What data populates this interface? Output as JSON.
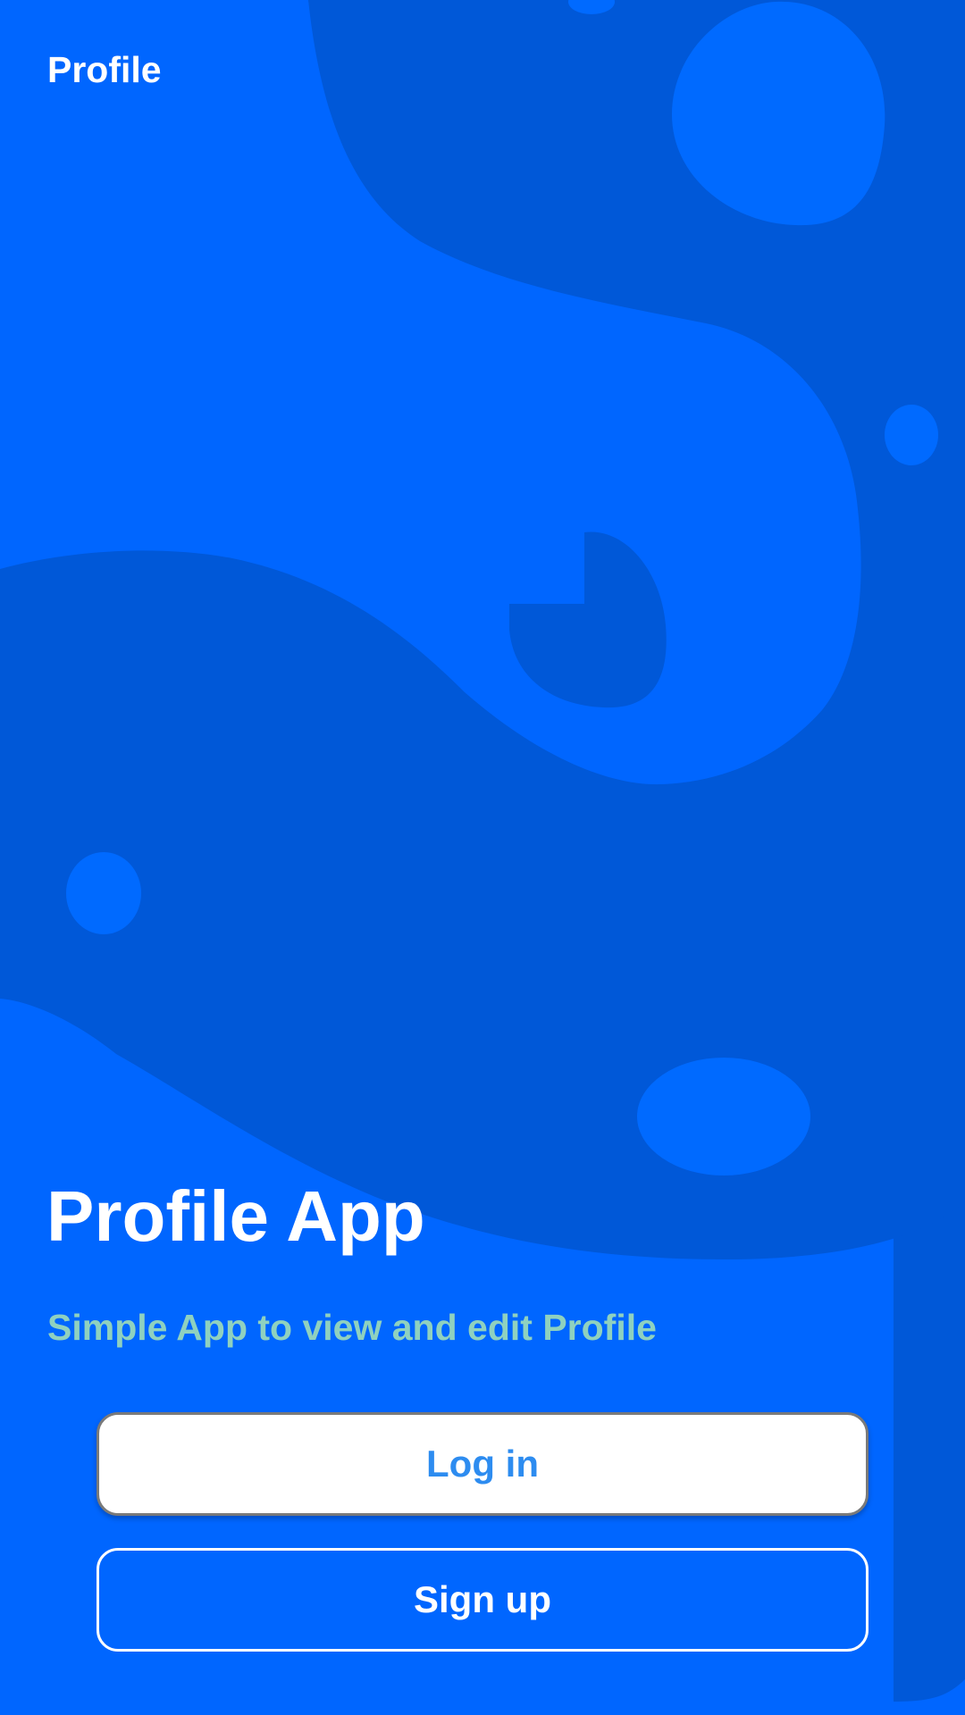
{
  "header": {
    "title": "Profile"
  },
  "hero": {
    "title": "Profile App",
    "subtitle": "Simple App to view and edit Profile"
  },
  "actions": {
    "login_label": "Log in",
    "signup_label": "Sign up"
  },
  "colors": {
    "background": "#0066FF",
    "background_shape": "#0058D8",
    "subtitle_text": "#8FD1BF",
    "login_text": "#2D8CF0"
  }
}
